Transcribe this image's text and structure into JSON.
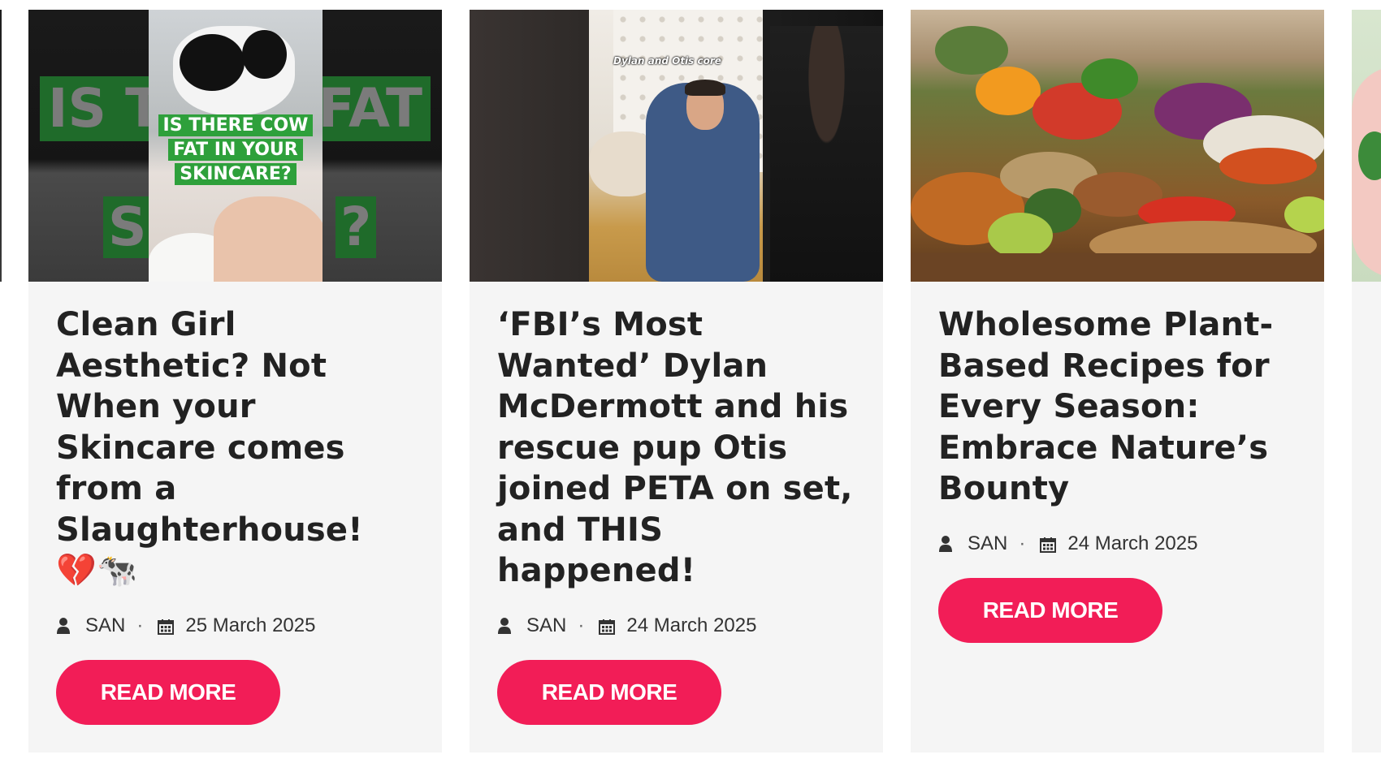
{
  "cards": [
    {
      "image_text": {
        "big_left": "IS TH",
        "big_right": "FAT",
        "big_bottom_left": "S",
        "big_bottom_right": "?",
        "overlay": "IS THERE COW FAT IN YOUR SKINCARE?"
      },
      "title": "Clean Girl Aesthetic? Not When your Skincare comes from a Slaughterhouse! 💔🐄",
      "author": "SAN",
      "separator": "·",
      "date": "25 March 2025",
      "button_label": "READ MORE"
    },
    {
      "image_text": {
        "caption": "Dylan and Otis core"
      },
      "title": "‘FBI’s Most Wanted’ Dylan McDermott and his rescue pup Otis joined PETA on set, and THIS happened!",
      "author": "SAN",
      "separator": "·",
      "date": "24 March 2025",
      "button_label": "READ MORE"
    },
    {
      "title": "Wholesome Plant-Based Recipes for Every Season: Embrace Nature’s Bounty",
      "author": "SAN",
      "separator": "·",
      "date": "24 March 2025",
      "button_label": "READ MORE"
    }
  ],
  "icons": {
    "author": "person-icon",
    "date": "calendar-icon"
  },
  "colors": {
    "button_bg": "#f21d57",
    "card_bg": "#f5f5f5",
    "title_text": "#222222"
  }
}
